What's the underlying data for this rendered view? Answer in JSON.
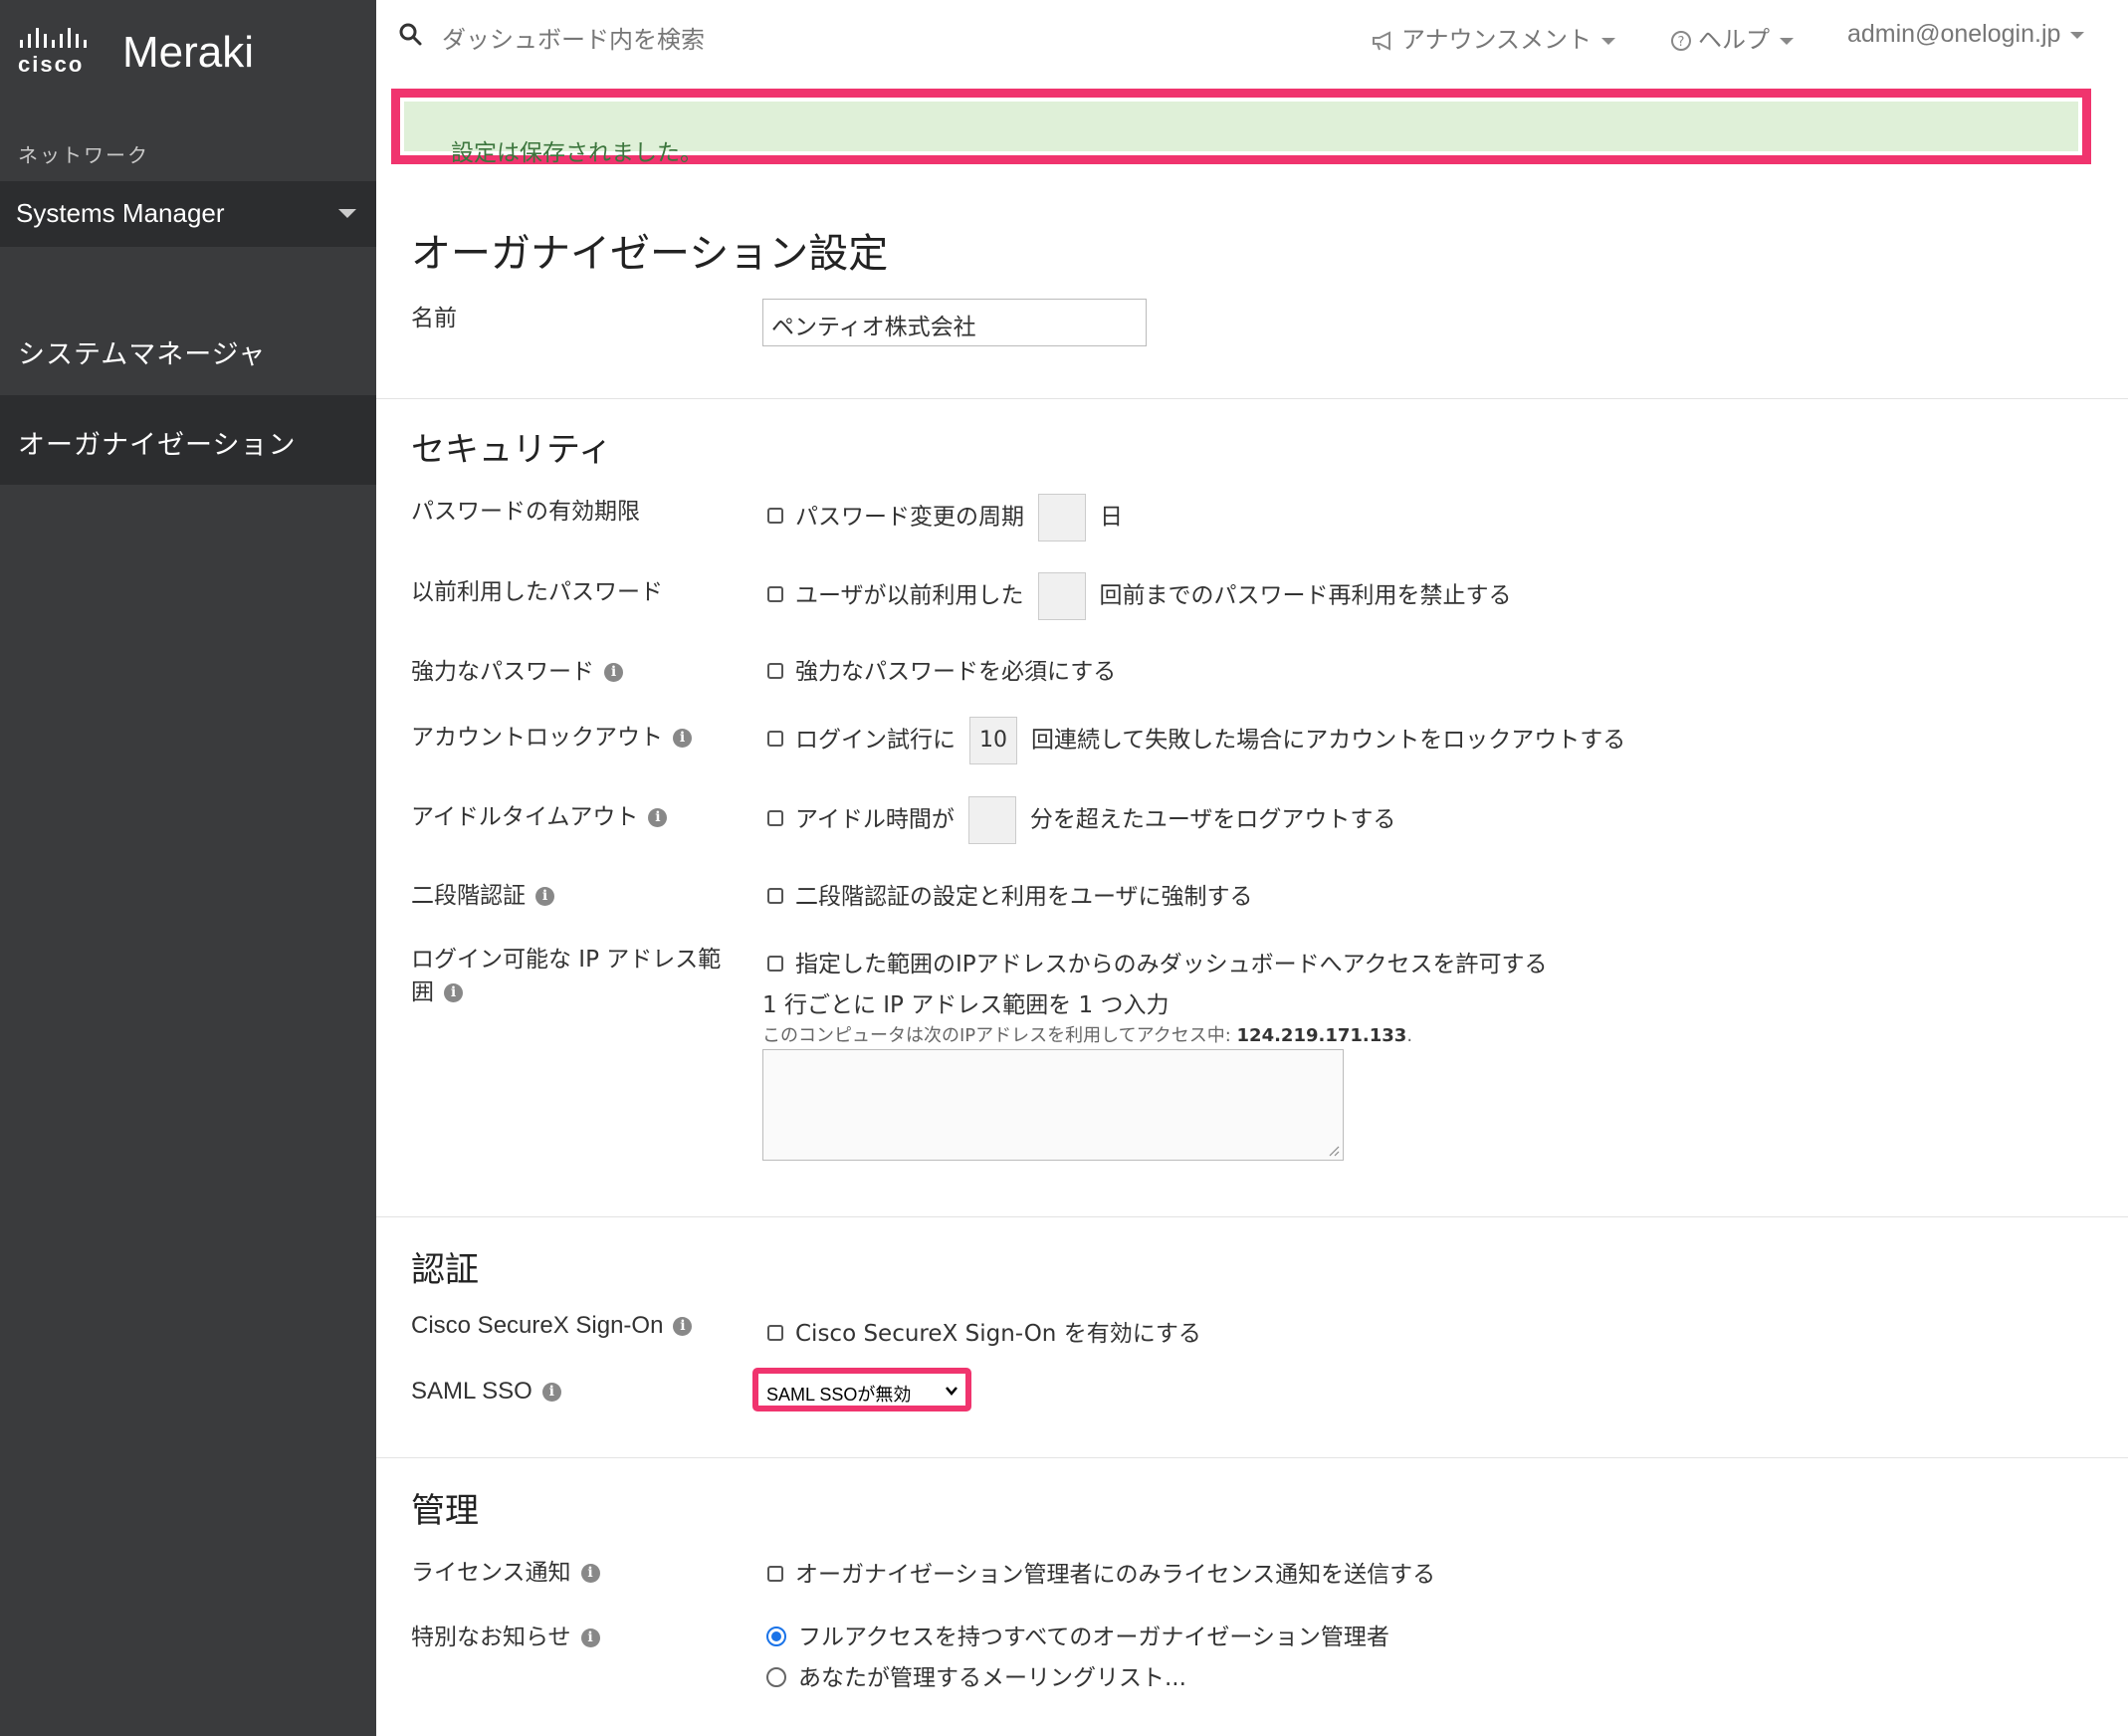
{
  "sidebar": {
    "logo_cisco": "cisco",
    "logo_meraki": "Meraki",
    "network_label": "ネットワーク",
    "network_selected": "Systems Manager",
    "items": [
      {
        "label": "システムマネージャ"
      },
      {
        "label": "オーガナイゼーション"
      }
    ]
  },
  "topbar": {
    "search_placeholder": "ダッシュボード内を検索",
    "announcements": "アナウンスメント",
    "help": "ヘルプ",
    "account": "admin@onelogin.jp"
  },
  "alert": {
    "text": "設定は保存されました。"
  },
  "page_title": "オーガナイゼーション設定",
  "name_field": {
    "label": "名前",
    "value": "ペンティオ株式会社"
  },
  "security": {
    "heading": "セキュリティ",
    "password_expiry": {
      "label": "パスワードの有効期限",
      "checkbox": "パスワード変更の周期",
      "value": "",
      "suffix": "日"
    },
    "previous_passwords": {
      "label": "以前利用したパスワード",
      "checkbox": "ユーザが以前利用した",
      "value": "",
      "suffix": "回前までのパスワード再利用を禁止する"
    },
    "strong_password": {
      "label": "強力なパスワード",
      "checkbox": "強力なパスワードを必須にする"
    },
    "account_lockout": {
      "label": "アカウントロックアウト",
      "checkbox": "ログイン試行に",
      "value": "10",
      "suffix": "回連続して失敗した場合にアカウントをロックアウトする"
    },
    "idle_timeout": {
      "label": "アイドルタイムアウト",
      "checkbox": "アイドル時間が",
      "value": "",
      "suffix": "分を超えたユーザをログアウトする"
    },
    "two_factor": {
      "label": "二段階認証",
      "checkbox": "二段階認証の設定と利用をユーザに強制する"
    },
    "ip_range": {
      "label_line1": "ログイン可能な IP アドレス範",
      "label_line2": "囲",
      "checkbox": "指定した範囲のIPアドレスからのみダッシュボードへアクセスを許可する",
      "instruction": "1 行ごとに IP アドレス範囲を 1 つ入力",
      "note_prefix": "このコンピュータは次のIPアドレスを利用してアクセス中: ",
      "ip": "124.219.171.133",
      "note_suffix": ".",
      "value": ""
    }
  },
  "auth": {
    "heading": "認証",
    "securex": {
      "label": "Cisco SecureX Sign-On",
      "checkbox": "Cisco SecureX Sign-On を有効にする"
    },
    "saml": {
      "label": "SAML SSO",
      "selected": "SAML SSOが無効"
    }
  },
  "admin": {
    "heading": "管理",
    "license": {
      "label": "ライセンス通知",
      "checkbox": "オーガナイゼーション管理者にのみライセンス通知を送信する"
    },
    "special_notice": {
      "label": "特別なお知らせ",
      "option1": "フルアクセスを持つすべてのオーガナイゼーション管理者",
      "option2": "あなたが管理するメーリングリスト..."
    }
  },
  "colors": {
    "sidebar_bg": "#3a3b3d",
    "alert_bg": "#dff0d8",
    "highlight": "#f0346e",
    "radio_accent": "#1a73e8"
  }
}
